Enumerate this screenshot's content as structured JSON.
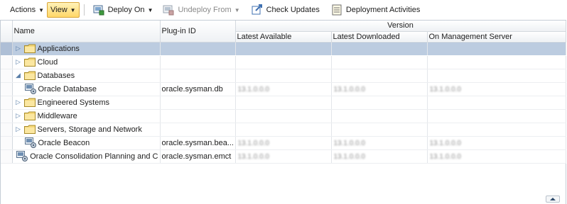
{
  "toolbar": {
    "actions_label": "Actions",
    "view_label": "View",
    "deploy_on_label": "Deploy On",
    "undeploy_from_label": "Undeploy From",
    "check_updates_label": "Check Updates",
    "deployment_activities_label": "Deployment Activities"
  },
  "table": {
    "headers": {
      "name": "Name",
      "plugin_id": "Plug-in ID",
      "version_group": "Version",
      "latest_available": "Latest Available",
      "latest_downloaded": "Latest Downloaded",
      "on_management_server": "On Management Server"
    },
    "rows": [
      {
        "name": "Applications",
        "plugin_id": "",
        "latest_available": "",
        "latest_downloaded": "",
        "on_management_server": "",
        "icon": "folder-icon",
        "state": "collapsed"
      },
      {
        "name": "Cloud",
        "plugin_id": "",
        "latest_available": "",
        "latest_downloaded": "",
        "on_management_server": "",
        "icon": "folder-icon",
        "state": "collapsed"
      },
      {
        "name": "Databases",
        "plugin_id": "",
        "latest_available": "",
        "latest_downloaded": "",
        "on_management_server": "",
        "icon": "folder-icon",
        "state": "expanded"
      },
      {
        "name": "Oracle Database",
        "plugin_id": "oracle.sysman.db",
        "latest_available": "13.1.0.0.0",
        "latest_downloaded": "13.1.0.0.0",
        "on_management_server": "13.1.0.0.0",
        "icon": "target-icon",
        "state": "leaf"
      },
      {
        "name": "Engineered Systems",
        "plugin_id": "",
        "latest_available": "",
        "latest_downloaded": "",
        "on_management_server": "",
        "icon": "folder-icon",
        "state": "collapsed"
      },
      {
        "name": "Middleware",
        "plugin_id": "",
        "latest_available": "",
        "latest_downloaded": "",
        "on_management_server": "",
        "icon": "folder-icon",
        "state": "collapsed"
      },
      {
        "name": "Servers, Storage and Network",
        "plugin_id": "",
        "latest_available": "",
        "latest_downloaded": "",
        "on_management_server": "",
        "icon": "folder-icon",
        "state": "collapsed"
      },
      {
        "name": "Oracle Beacon",
        "plugin_id": "oracle.sysman.bea...",
        "latest_available": "13.1.0.0.0",
        "latest_downloaded": "13.1.0.0.0",
        "on_management_server": "13.1.0.0.0",
        "icon": "target-icon",
        "state": "leaf"
      },
      {
        "name": "Oracle Consolidation Planning and C",
        "plugin_id": "oracle.sysman.emct",
        "latest_available": "13.1.0.0.0",
        "latest_downloaded": "13.1.0.0.0",
        "on_management_server": "13.1.0.0.0",
        "icon": "target-icon",
        "state": "leaf"
      }
    ]
  },
  "colors": {
    "selected_row": "#bccce0",
    "view_button": "#ffd768",
    "expander": "#5a7fa8"
  }
}
